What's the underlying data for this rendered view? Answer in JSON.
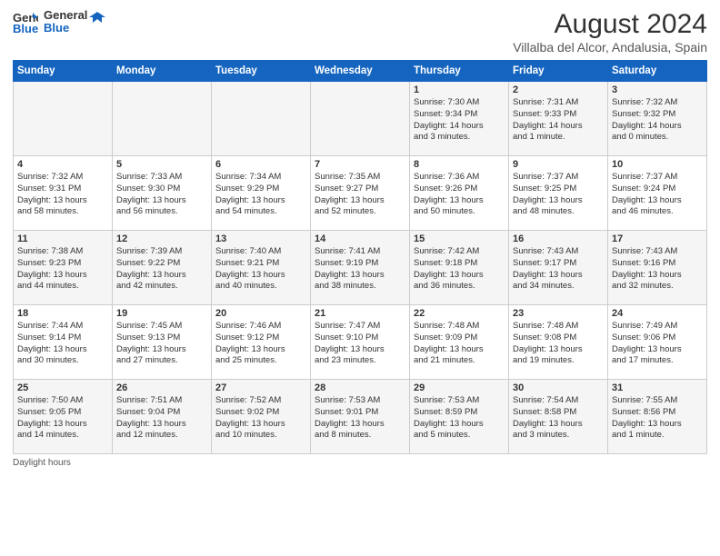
{
  "logo": {
    "line1": "General",
    "line2": "Blue"
  },
  "title": "August 2024",
  "subtitle": "Villalba del Alcor, Andalusia, Spain",
  "days_of_week": [
    "Sunday",
    "Monday",
    "Tuesday",
    "Wednesday",
    "Thursday",
    "Friday",
    "Saturday"
  ],
  "weeks": [
    [
      {
        "day": "",
        "content": ""
      },
      {
        "day": "",
        "content": ""
      },
      {
        "day": "",
        "content": ""
      },
      {
        "day": "",
        "content": ""
      },
      {
        "day": "1",
        "content": "Sunrise: 7:30 AM\nSunset: 9:34 PM\nDaylight: 14 hours\nand 3 minutes."
      },
      {
        "day": "2",
        "content": "Sunrise: 7:31 AM\nSunset: 9:33 PM\nDaylight: 14 hours\nand 1 minute."
      },
      {
        "day": "3",
        "content": "Sunrise: 7:32 AM\nSunset: 9:32 PM\nDaylight: 14 hours\nand 0 minutes."
      }
    ],
    [
      {
        "day": "4",
        "content": "Sunrise: 7:32 AM\nSunset: 9:31 PM\nDaylight: 13 hours\nand 58 minutes."
      },
      {
        "day": "5",
        "content": "Sunrise: 7:33 AM\nSunset: 9:30 PM\nDaylight: 13 hours\nand 56 minutes."
      },
      {
        "day": "6",
        "content": "Sunrise: 7:34 AM\nSunset: 9:29 PM\nDaylight: 13 hours\nand 54 minutes."
      },
      {
        "day": "7",
        "content": "Sunrise: 7:35 AM\nSunset: 9:27 PM\nDaylight: 13 hours\nand 52 minutes."
      },
      {
        "day": "8",
        "content": "Sunrise: 7:36 AM\nSunset: 9:26 PM\nDaylight: 13 hours\nand 50 minutes."
      },
      {
        "day": "9",
        "content": "Sunrise: 7:37 AM\nSunset: 9:25 PM\nDaylight: 13 hours\nand 48 minutes."
      },
      {
        "day": "10",
        "content": "Sunrise: 7:37 AM\nSunset: 9:24 PM\nDaylight: 13 hours\nand 46 minutes."
      }
    ],
    [
      {
        "day": "11",
        "content": "Sunrise: 7:38 AM\nSunset: 9:23 PM\nDaylight: 13 hours\nand 44 minutes."
      },
      {
        "day": "12",
        "content": "Sunrise: 7:39 AM\nSunset: 9:22 PM\nDaylight: 13 hours\nand 42 minutes."
      },
      {
        "day": "13",
        "content": "Sunrise: 7:40 AM\nSunset: 9:21 PM\nDaylight: 13 hours\nand 40 minutes."
      },
      {
        "day": "14",
        "content": "Sunrise: 7:41 AM\nSunset: 9:19 PM\nDaylight: 13 hours\nand 38 minutes."
      },
      {
        "day": "15",
        "content": "Sunrise: 7:42 AM\nSunset: 9:18 PM\nDaylight: 13 hours\nand 36 minutes."
      },
      {
        "day": "16",
        "content": "Sunrise: 7:43 AM\nSunset: 9:17 PM\nDaylight: 13 hours\nand 34 minutes."
      },
      {
        "day": "17",
        "content": "Sunrise: 7:43 AM\nSunset: 9:16 PM\nDaylight: 13 hours\nand 32 minutes."
      }
    ],
    [
      {
        "day": "18",
        "content": "Sunrise: 7:44 AM\nSunset: 9:14 PM\nDaylight: 13 hours\nand 30 minutes."
      },
      {
        "day": "19",
        "content": "Sunrise: 7:45 AM\nSunset: 9:13 PM\nDaylight: 13 hours\nand 27 minutes."
      },
      {
        "day": "20",
        "content": "Sunrise: 7:46 AM\nSunset: 9:12 PM\nDaylight: 13 hours\nand 25 minutes."
      },
      {
        "day": "21",
        "content": "Sunrise: 7:47 AM\nSunset: 9:10 PM\nDaylight: 13 hours\nand 23 minutes."
      },
      {
        "day": "22",
        "content": "Sunrise: 7:48 AM\nSunset: 9:09 PM\nDaylight: 13 hours\nand 21 minutes."
      },
      {
        "day": "23",
        "content": "Sunrise: 7:48 AM\nSunset: 9:08 PM\nDaylight: 13 hours\nand 19 minutes."
      },
      {
        "day": "24",
        "content": "Sunrise: 7:49 AM\nSunset: 9:06 PM\nDaylight: 13 hours\nand 17 minutes."
      }
    ],
    [
      {
        "day": "25",
        "content": "Sunrise: 7:50 AM\nSunset: 9:05 PM\nDaylight: 13 hours\nand 14 minutes."
      },
      {
        "day": "26",
        "content": "Sunrise: 7:51 AM\nSunset: 9:04 PM\nDaylight: 13 hours\nand 12 minutes."
      },
      {
        "day": "27",
        "content": "Sunrise: 7:52 AM\nSunset: 9:02 PM\nDaylight: 13 hours\nand 10 minutes."
      },
      {
        "day": "28",
        "content": "Sunrise: 7:53 AM\nSunset: 9:01 PM\nDaylight: 13 hours\nand 8 minutes."
      },
      {
        "day": "29",
        "content": "Sunrise: 7:53 AM\nSunset: 8:59 PM\nDaylight: 13 hours\nand 5 minutes."
      },
      {
        "day": "30",
        "content": "Sunrise: 7:54 AM\nSunset: 8:58 PM\nDaylight: 13 hours\nand 3 minutes."
      },
      {
        "day": "31",
        "content": "Sunrise: 7:55 AM\nSunset: 8:56 PM\nDaylight: 13 hours\nand 1 minute."
      }
    ]
  ],
  "footer": "Daylight hours"
}
